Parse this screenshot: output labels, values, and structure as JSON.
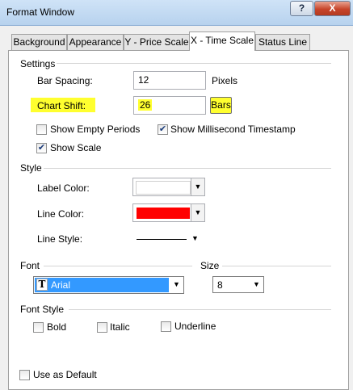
{
  "window": {
    "title": "Format Window",
    "help_label": "?",
    "close_label": "X"
  },
  "tabs": [
    {
      "label": "Background"
    },
    {
      "label": "Appearance"
    },
    {
      "label": "Y - Price Scale"
    },
    {
      "label": "X - Time Scale"
    },
    {
      "label": "Status Line"
    }
  ],
  "settings": {
    "header": "Settings",
    "bar_spacing": {
      "label": "Bar Spacing:",
      "value": "12",
      "unit": "Pixels"
    },
    "chart_shift": {
      "label": "Chart Shift:",
      "value": "26",
      "unit_button": "Bars"
    },
    "show_empty_periods": {
      "label": "Show Empty Periods",
      "checked": false
    },
    "show_millisecond": {
      "label": "Show Millisecond Timestamp",
      "checked": true
    },
    "show_scale": {
      "label": "Show Scale",
      "checked": true
    }
  },
  "style": {
    "header": "Style",
    "label_color": {
      "label": "Label Color:",
      "color": "#ffffff"
    },
    "line_color": {
      "label": "Line Color:",
      "color": "#ff0000"
    },
    "line_style": {
      "label": "Line Style:"
    }
  },
  "font": {
    "header": "Font",
    "family": "Arial",
    "family_icon_glyph": "T",
    "size_header": "Size",
    "size": "8"
  },
  "font_style": {
    "header": "Font Style",
    "bold": {
      "label": "Bold",
      "checked": false
    },
    "italic": {
      "label": "Italic",
      "checked": false
    },
    "underline": {
      "label": "Underline",
      "checked": false
    }
  },
  "use_as_default": {
    "label": "Use as Default",
    "checked": false
  },
  "colors": {
    "highlight": "#ffff2f",
    "selection": "#3399ff"
  }
}
